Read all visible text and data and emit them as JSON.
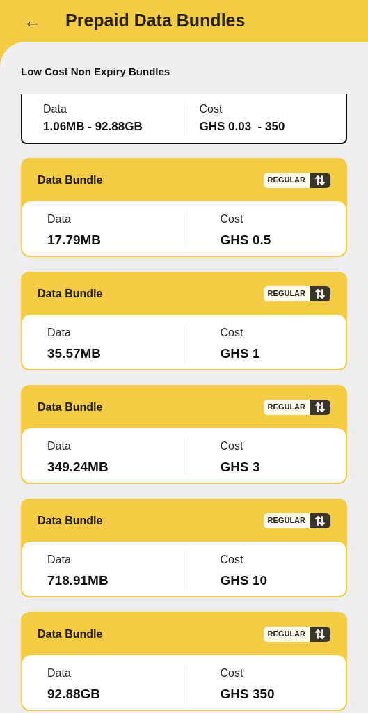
{
  "header": {
    "back": "←",
    "title": "Prepaid Data Bundles"
  },
  "section_title": "Low Cost Non Expiry Bundles",
  "summary": {
    "data_label": "Data",
    "data_value": "1.06MB - 92.88GB",
    "cost_label": "Cost",
    "cost_value": "GHS 0.03  - 350"
  },
  "bundles": [
    {
      "title": "Data Bundle",
      "tag": "REGULAR",
      "data_label": "Data",
      "data_value": "17.79MB",
      "cost_label": "Cost",
      "cost_value": "GHS 0.5"
    },
    {
      "title": "Data Bundle",
      "tag": "REGULAR",
      "data_label": "Data",
      "data_value": "35.57MB",
      "cost_label": "Cost",
      "cost_value": "GHS 1"
    },
    {
      "title": "Data Bundle",
      "tag": "REGULAR",
      "data_label": "Data",
      "data_value": "349.24MB",
      "cost_label": "Cost",
      "cost_value": "GHS 3"
    },
    {
      "title": "Data Bundle",
      "tag": "REGULAR",
      "data_label": "Data",
      "data_value": "718.91MB",
      "cost_label": "Cost",
      "cost_value": "GHS 10"
    },
    {
      "title": "Data Bundle",
      "tag": "REGULAR",
      "data_label": "Data",
      "data_value": "92.88GB",
      "cost_label": "Cost",
      "cost_value": "GHS 350"
    }
  ]
}
